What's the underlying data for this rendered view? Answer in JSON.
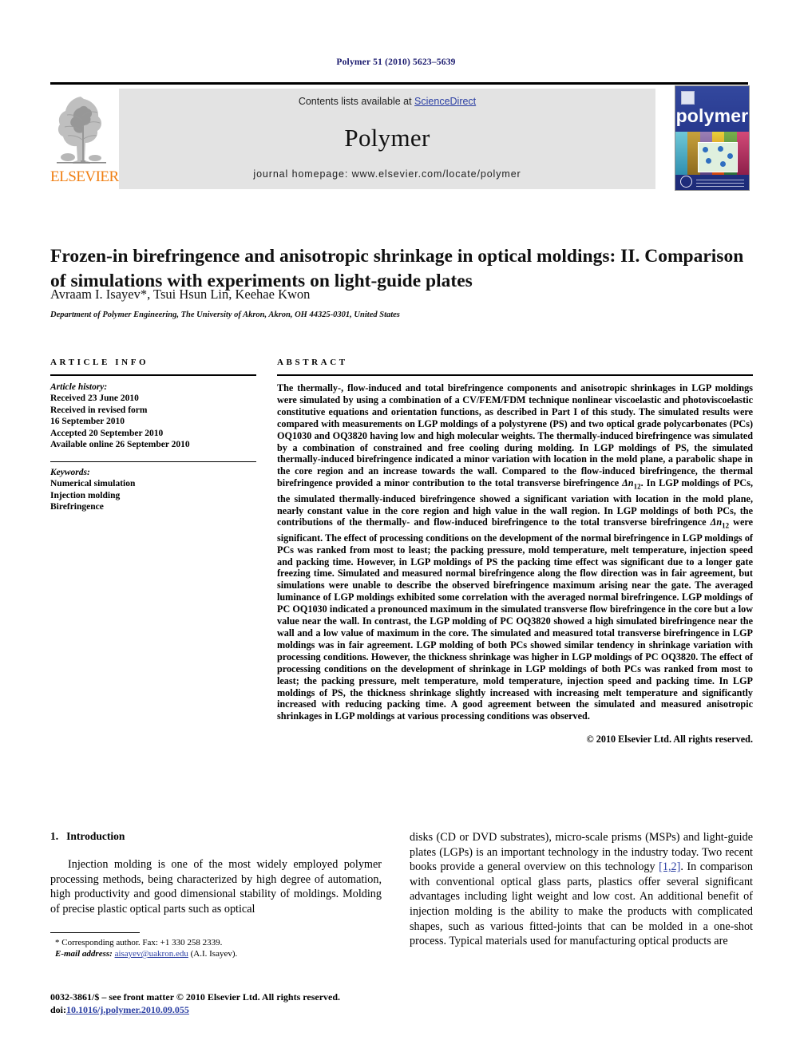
{
  "running_head": "Polymer 51 (2010) 5623–5639",
  "masthead": {
    "contents_prefix": "Contents lists available at ",
    "sciencedirect": "ScienceDirect",
    "journal_title": "Polymer",
    "homepage": "journal homepage: www.elsevier.com/locate/polymer",
    "publisher_wordmark": "ELSEVIER",
    "publisher_logo_icon": "elsevier-tree-logo",
    "cover_wordmark": "polymer",
    "colors": {
      "link": "#2b3fa3",
      "elsevier_orange": "#f07f13",
      "band_gray": "#e3e3e3",
      "cover_blue": "#2a3f96",
      "running_head_navy": "#1a1a6e"
    }
  },
  "article": {
    "title": "Frozen-in birefringence and anisotropic shrinkage in optical moldings: II. Comparison of simulations with experiments on light-guide plates",
    "authors": "Avraam I. Isayev*, Tsui Hsun Lin, Keehae Kwon",
    "affiliation": "Department of Polymer Engineering, The University of Akron, Akron, OH 44325-0301, United States"
  },
  "article_info": {
    "heading": "ARTICLE INFO",
    "history_label": "Article history:",
    "history": [
      "Received 23 June 2010",
      "Received in revised form",
      "16 September 2010",
      "Accepted 20 September 2010",
      "Available online 26 September 2010"
    ],
    "keywords_label": "Keywords:",
    "keywords": [
      "Numerical simulation",
      "Injection molding",
      "Birefringence"
    ]
  },
  "abstract": {
    "heading": "ABSTRACT",
    "body_part_1": "The thermally-, flow-induced and total birefringence components and anisotropic shrinkages in LGP moldings were simulated by using a combination of a CV/FEM/FDM technique nonlinear viscoelastic and photoviscoelastic constitutive equations and orientation functions, as described in Part I of this study. The simulated results were compared with measurements on LGP moldings of a polystyrene (PS) and two optical grade polycarbonates (PCs) OQ1030 and OQ3820 having low and high molecular weights. The thermally-induced birefringence was simulated by a combination of constrained and free cooling during molding. In LGP moldings of PS, the simulated thermally-induced birefringence indicated a minor variation with location in the mold plane, a parabolic shape in the core region and an increase towards the wall. Compared to the flow-induced birefringence, the thermal birefringence provided a minor contribution to the total transverse birefringence ",
    "sym_1": "Δn",
    "sub_1": "12",
    "body_part_2": ". In LGP moldings of PCs, the simulated thermally-induced birefringence showed a significant variation with location in the mold plane, nearly constant value in the core region and high value in the wall region. In LGP moldings of both PCs, the contributions of the thermally- and flow-induced birefringence to the total transverse birefringence ",
    "sym_2": "Δn",
    "sub_2": "12",
    "body_part_3": " were significant. The effect of processing conditions on the development of the normal birefringence in LGP moldings of PCs was ranked from most to least; the packing pressure, mold temperature, melt temperature, injection speed and packing time. However, in LGP moldings of PS the packing time effect was significant due to a longer gate freezing time. Simulated and measured normal birefringence along the flow direction was in fair agreement, but simulations were unable to describe the observed birefringence maximum arising near the gate. The averaged luminance of LGP moldings exhibited some correlation with the averaged normal birefringence. LGP moldings of PC OQ1030 indicated a pronounced maximum in the simulated transverse flow birefringence in the core but a low value near the wall. In contrast, the LGP molding of PC OQ3820 showed a high simulated birefringence near the wall and a low value of maximum in the core. The simulated and measured total transverse birefringence in LGP moldings was in fair agreement. LGP molding of both PCs showed similar tendency in shrinkage variation with processing conditions. However, the thickness shrinkage was higher in LGP moldings of PC OQ3820. The effect of processing conditions on the development of shrinkage in LGP moldings of both PCs was ranked from most to least; the packing pressure, melt temperature, mold temperature, injection speed and packing time. In LGP moldings of PS, the thickness shrinkage slightly increased with increasing melt temperature and significantly increased with reducing packing time. A good agreement between the simulated and measured anisotropic shrinkages in LGP moldings at various processing conditions was observed.",
    "copyright": "© 2010 Elsevier Ltd. All rights reserved."
  },
  "introduction": {
    "number": "1.",
    "heading": "Introduction",
    "left_paragraph": "Injection molding is one of the most widely employed polymer processing methods, being characterized by high degree of automation, high productivity and good dimensional stability of moldings. Molding of precise plastic optical parts such as optical",
    "right_paragraph_part_1": "disks (CD or DVD substrates), micro-scale prisms (MSPs) and light-guide plates (LGPs) is an important technology in the industry today. Two recent books provide a general overview on this technology ",
    "right_citation": "[1,2]",
    "right_paragraph_part_2": ". In comparison with conventional optical glass parts, plastics offer several significant advantages including light weight and low cost. An additional benefit of injection molding is the ability to make the products with complicated shapes, such as various fitted-joints that can be molded in a one-shot process. Typical materials used for manufacturing optical products are"
  },
  "footnote": {
    "corresponding": "* Corresponding author. Fax: +1 330 258 2339.",
    "email_label": "E-mail address:",
    "email": "aisayev@uakron.edu",
    "email_suffix": " (A.I. Isayev)."
  },
  "imprint": {
    "line1": "0032-3861/$ – see front matter © 2010 Elsevier Ltd. All rights reserved.",
    "doi_label": "doi:",
    "doi": "10.1016/j.polymer.2010.09.055"
  }
}
